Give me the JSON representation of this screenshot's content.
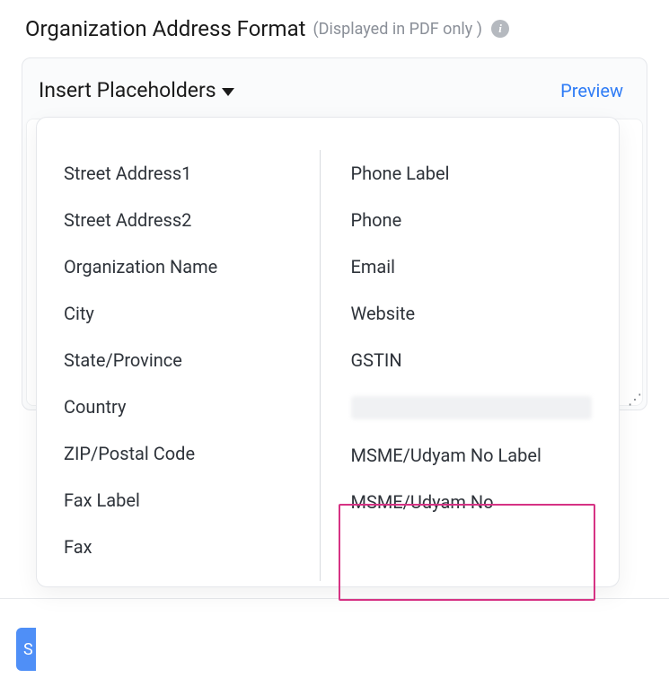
{
  "header": {
    "title": "Organization Address Format",
    "sub": "(Displayed in PDF only )"
  },
  "panel": {
    "insert_label": "Insert Placeholders",
    "preview_label": "Preview"
  },
  "save_button_partial": "S",
  "dropdown": {
    "left": [
      "Street Address1",
      "Street Address2",
      "Organization Name",
      "City",
      "State/Province",
      "Country",
      "ZIP/Postal Code",
      "Fax Label",
      "Fax"
    ],
    "right": [
      "Phone Label",
      "Phone",
      "Email",
      "Website",
      "GSTIN"
    ],
    "right_highlighted": [
      "MSME/Udyam No Label",
      "MSME/Udyam No"
    ]
  }
}
